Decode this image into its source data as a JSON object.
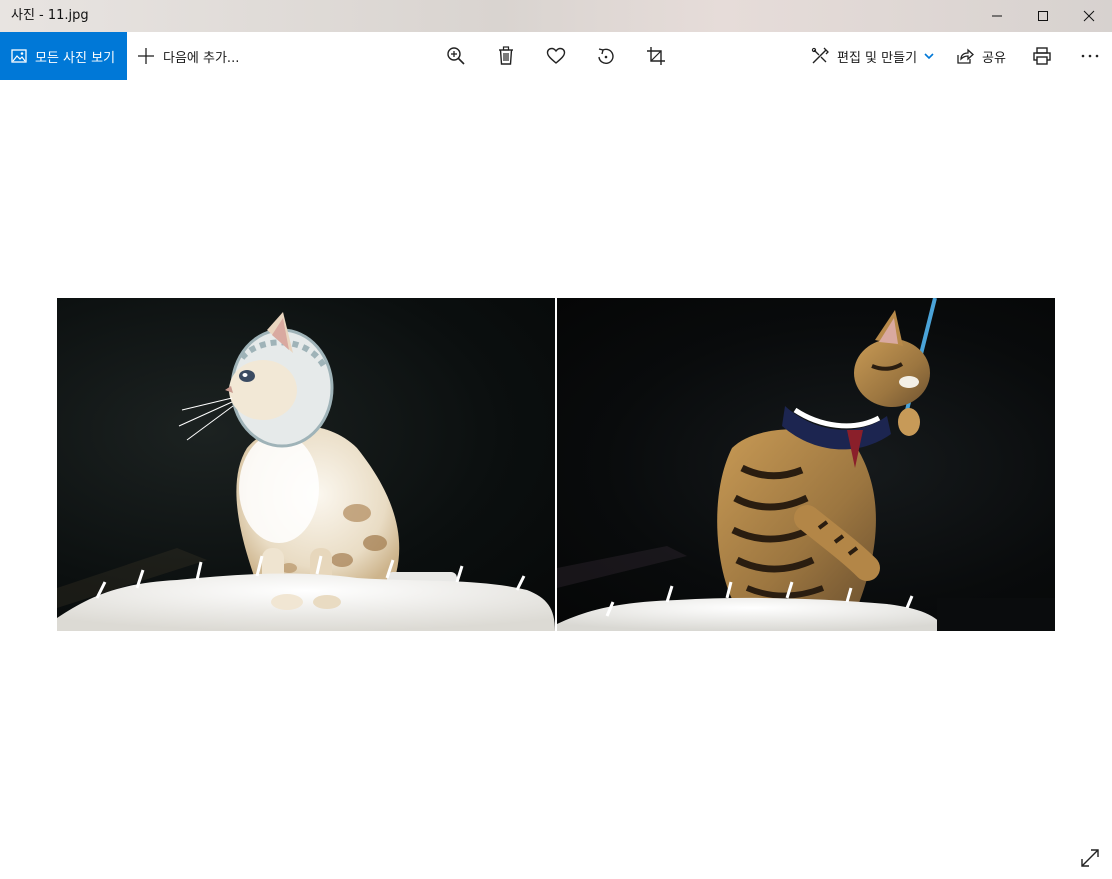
{
  "window": {
    "title": "사진 - 11.jpg"
  },
  "toolbar": {
    "all_photos_label": "모든 사진 보기",
    "add_to_label": "다음에 추가...",
    "edit_create_label": "편집 및 만들기",
    "share_label": "공유",
    "icons": [
      "zoom-in-icon",
      "delete-icon",
      "favorite-icon",
      "rotate-icon",
      "crop-icon",
      "print-icon",
      "more-icon"
    ],
    "accent_color": "#0078d7"
  },
  "photo": {
    "panels": [
      "cream-cat-with-collar",
      "striped-cat-playing-with-wand"
    ]
  }
}
